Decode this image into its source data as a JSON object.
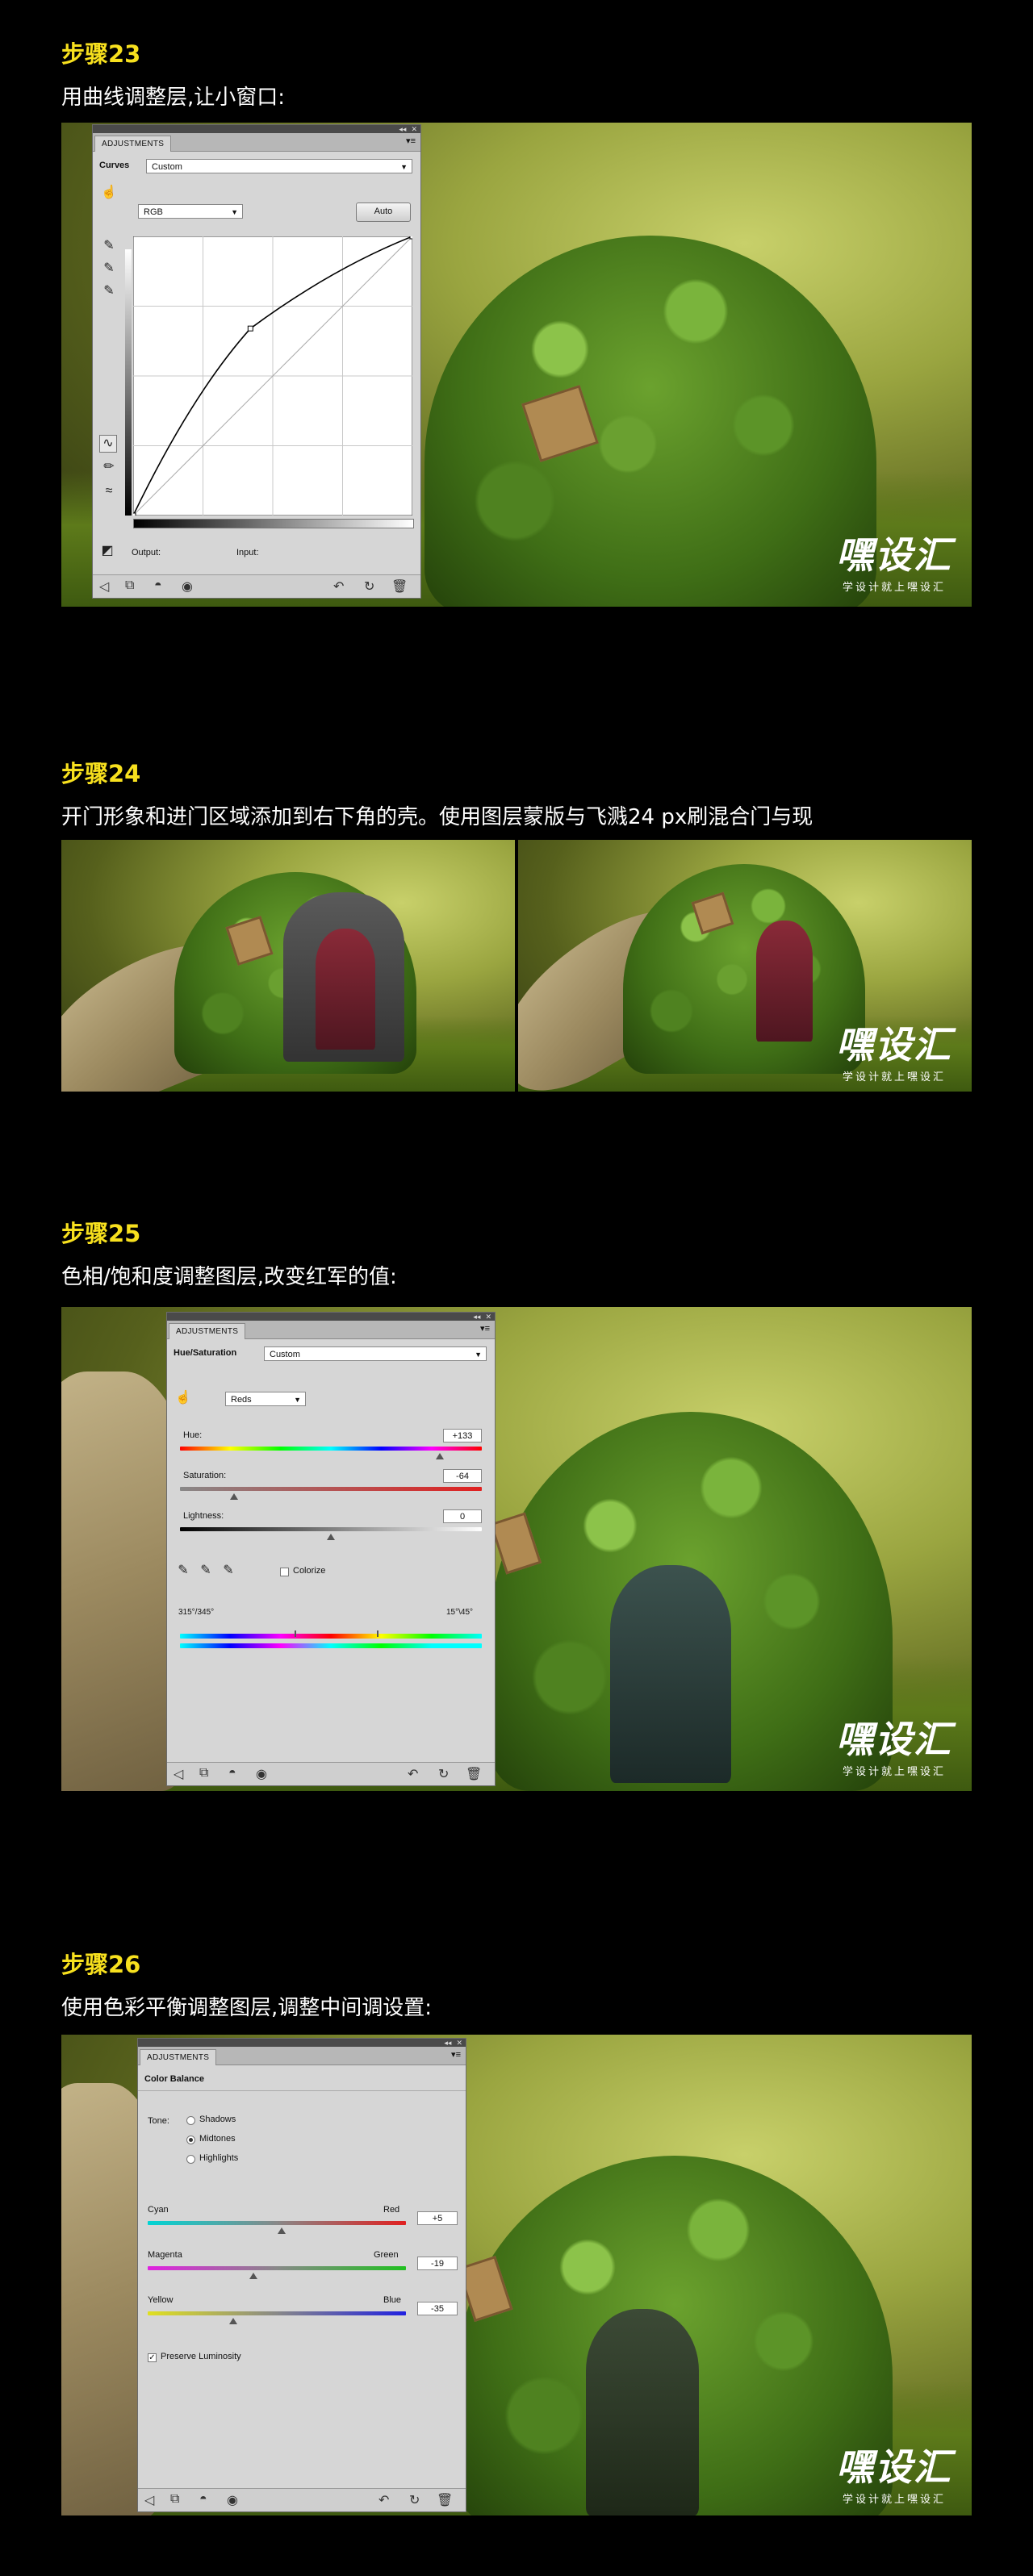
{
  "steps": [
    {
      "title": "步骤23",
      "desc": "用曲线调整层,让小窗口:",
      "panel": {
        "tab": "ADJUSTMENTS",
        "type_label": "Curves",
        "preset": "Custom",
        "channel": "RGB",
        "auto_label": "Auto",
        "output_label": "Output:",
        "input_label": "Input:",
        "curve_points": [
          [
            0,
            0
          ],
          [
            0.42,
            0.67
          ],
          [
            1,
            1
          ]
        ]
      }
    },
    {
      "title": "步骤24",
      "desc": "开门形象和进门区域添加到右下角的壳。使用图层蒙版与飞溅24 px刷混合门与现"
    },
    {
      "title": "步骤25",
      "desc": "色相/饱和度调整图层,改变红军的值:",
      "panel": {
        "tab": "ADJUSTMENTS",
        "type_label": "Hue/Saturation",
        "preset": "Custom",
        "channel": "Reds",
        "hue_label": "Hue:",
        "hue_value": "+133",
        "saturation_label": "Saturation:",
        "saturation_value": "-64",
        "lightness_label": "Lightness:",
        "lightness_value": "0",
        "colorize_label": "Colorize",
        "range_left": "315°/345°",
        "range_right": "15°\\45°",
        "hue_level": 0.86,
        "saturation_level": 0.18,
        "lightness_level": 0.5
      }
    },
    {
      "title": "步骤26",
      "desc": "使用色彩平衡调整图层,调整中间调设置:",
      "panel": {
        "tab": "ADJUSTMENTS",
        "type_label": "Color Balance",
        "tone_label": "Tone:",
        "tones": [
          "Shadows",
          "Midtones",
          "Highlights"
        ],
        "selected_tone": "Midtones",
        "sliders": [
          {
            "left": "Cyan",
            "right": "Red",
            "value": "+5",
            "level": 0.52
          },
          {
            "left": "Magenta",
            "right": "Green",
            "value": "-19",
            "level": 0.41
          },
          {
            "left": "Yellow",
            "right": "Blue",
            "value": "-35",
            "level": 0.33
          }
        ],
        "preserve_label": "Preserve Luminosity"
      }
    }
  ],
  "watermark": {
    "logo": "嘿设汇",
    "sub": "学设计就上嘿设汇"
  }
}
